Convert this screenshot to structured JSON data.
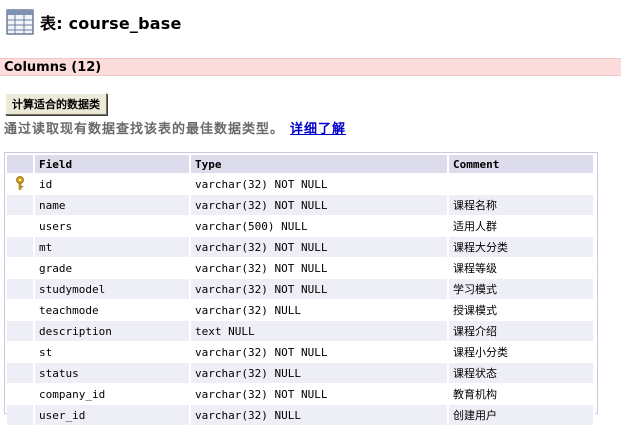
{
  "header": {
    "table_label": "表: course_base",
    "table_icon": "table-icon"
  },
  "columns_section": {
    "label": "Columns (12)"
  },
  "actions": {
    "calc_button": "计算适合的数据类",
    "hint_text": "通过读取现有数据查找该表的最佳数据类型。",
    "details_link": "详细了解"
  },
  "grid": {
    "headers": {
      "field": "Field",
      "type": "Type",
      "comment": "Comment"
    },
    "rows": [
      {
        "field": "id",
        "type": "varchar(32) NOT NULL",
        "comment": "",
        "key_icon": "primary-key-icon"
      },
      {
        "field": "name",
        "type": "varchar(32) NOT NULL",
        "comment": "课程名称"
      },
      {
        "field": "users",
        "type": "varchar(500) NULL",
        "comment": "适用人群"
      },
      {
        "field": "mt",
        "type": "varchar(32) NOT NULL",
        "comment": "课程大分类"
      },
      {
        "field": "grade",
        "type": "varchar(32) NOT NULL",
        "comment": "课程等级"
      },
      {
        "field": "studymodel",
        "type": "varchar(32) NOT NULL",
        "comment": "学习模式"
      },
      {
        "field": "teachmode",
        "type": "varchar(32) NULL",
        "comment": "授课模式"
      },
      {
        "field": "description",
        "type": "text NULL",
        "comment": "课程介绍"
      },
      {
        "field": "st",
        "type": "varchar(32) NOT NULL",
        "comment": "课程小分类"
      },
      {
        "field": "status",
        "type": "varchar(32) NULL",
        "comment": "课程状态"
      },
      {
        "field": "company_id",
        "type": "varchar(32) NOT NULL",
        "comment": "教育机构"
      },
      {
        "field": "user_id",
        "type": "varchar(32) NULL",
        "comment": "创建用户"
      }
    ]
  },
  "colors": {
    "columns_bar": "#fddcdc",
    "header_row": "#dcdcec",
    "alt_row": "#eeeef6",
    "link": "#0000cc",
    "key": "#d4a017"
  }
}
